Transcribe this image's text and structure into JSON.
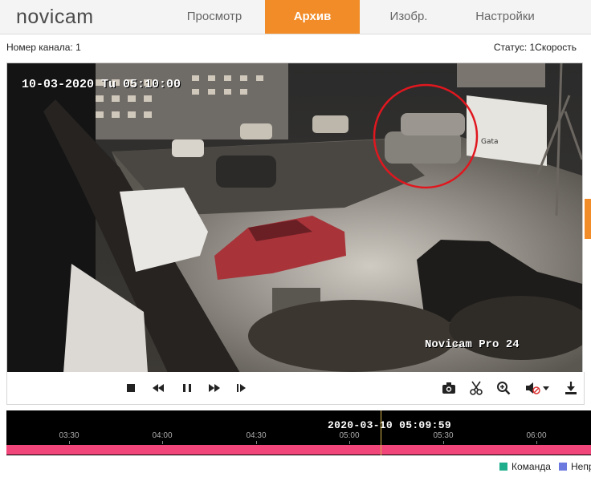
{
  "header": {
    "logo": "novicam",
    "tabs": [
      {
        "label": "Просмотр",
        "active": false
      },
      {
        "label": "Архив",
        "active": true
      },
      {
        "label": "Изобр.",
        "active": false
      },
      {
        "label": "Настройки",
        "active": false
      }
    ]
  },
  "info": {
    "channel": "Номер канала: 1",
    "status": "Статус: 1Скорость"
  },
  "video": {
    "timestamp": "10-03-2020 Tu 05:10:00",
    "watermark": "Novicam Pro 24",
    "sign_text": "Gata"
  },
  "controls": {
    "buttons": [
      "stop-icon",
      "rewind-icon",
      "pause-icon",
      "fast-forward-icon",
      "step-forward-icon",
      "camera-icon",
      "scissors-icon",
      "zoom-icon",
      "volume-muted-icon",
      "download-icon"
    ]
  },
  "timeline": {
    "current_time": "2020-03-10 05:09:59",
    "ticks": [
      "03:30",
      "04:00",
      "04:30",
      "05:00",
      "05:30",
      "06:00"
    ]
  },
  "legend": {
    "items": [
      {
        "label": "Команда",
        "color": "#1fae8c"
      },
      {
        "label": "Непр",
        "color": "#6c7ae0"
      }
    ]
  },
  "colors": {
    "accent": "#f28c28",
    "track": "#f0467a"
  }
}
